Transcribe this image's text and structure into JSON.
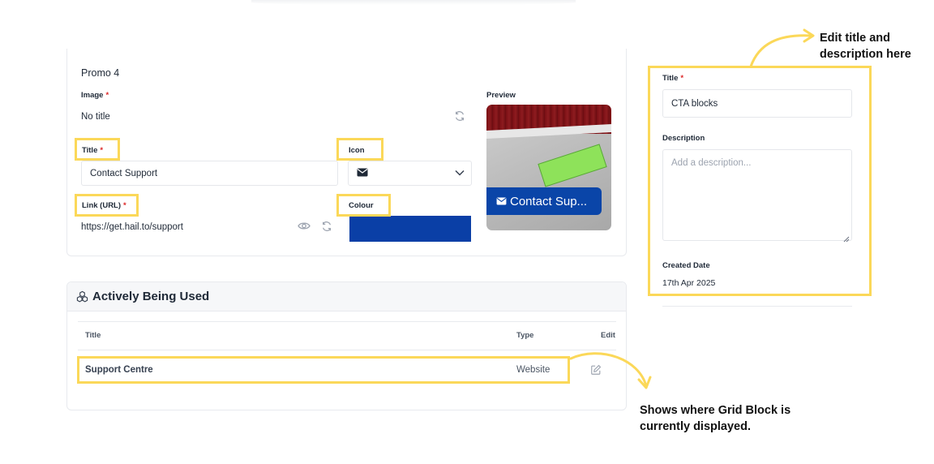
{
  "promo": {
    "heading": "Promo 4",
    "image_label": "Image",
    "image_value": "No title",
    "preview_label": "Preview",
    "title_label": "Title",
    "title_value": "Contact Support",
    "icon_label": "Icon",
    "link_label": "Link (URL)",
    "link_value": "https://get.hail.to/support",
    "colour_label": "Colour",
    "colour_value": "#0a3fa6",
    "preview_cta_text": "Contact Sup..."
  },
  "usage": {
    "heading": "Actively Being Used",
    "columns": [
      "Title",
      "Type",
      "Edit"
    ],
    "rows": [
      {
        "title": "Support Centre",
        "type": "Website"
      }
    ]
  },
  "panel": {
    "title_label": "Title",
    "title_value": "CTA blocks",
    "description_label": "Description",
    "description_placeholder": "Add a description...",
    "created_label": "Created Date",
    "created_value": "17th Apr 2025"
  },
  "annotations": {
    "edit_line1": "Edit title and",
    "edit_line2": "description here",
    "shows_line1": "Shows where Grid Block is",
    "shows_line2": "currently displayed."
  },
  "colors": {
    "highlight": "#fbd859",
    "required": "#dc2626",
    "brand": "#0a45a8"
  },
  "icons": [
    "refresh-icon",
    "envelope-icon",
    "chevron-down-icon",
    "eye-icon",
    "cubes-icon",
    "edit-icon"
  ]
}
